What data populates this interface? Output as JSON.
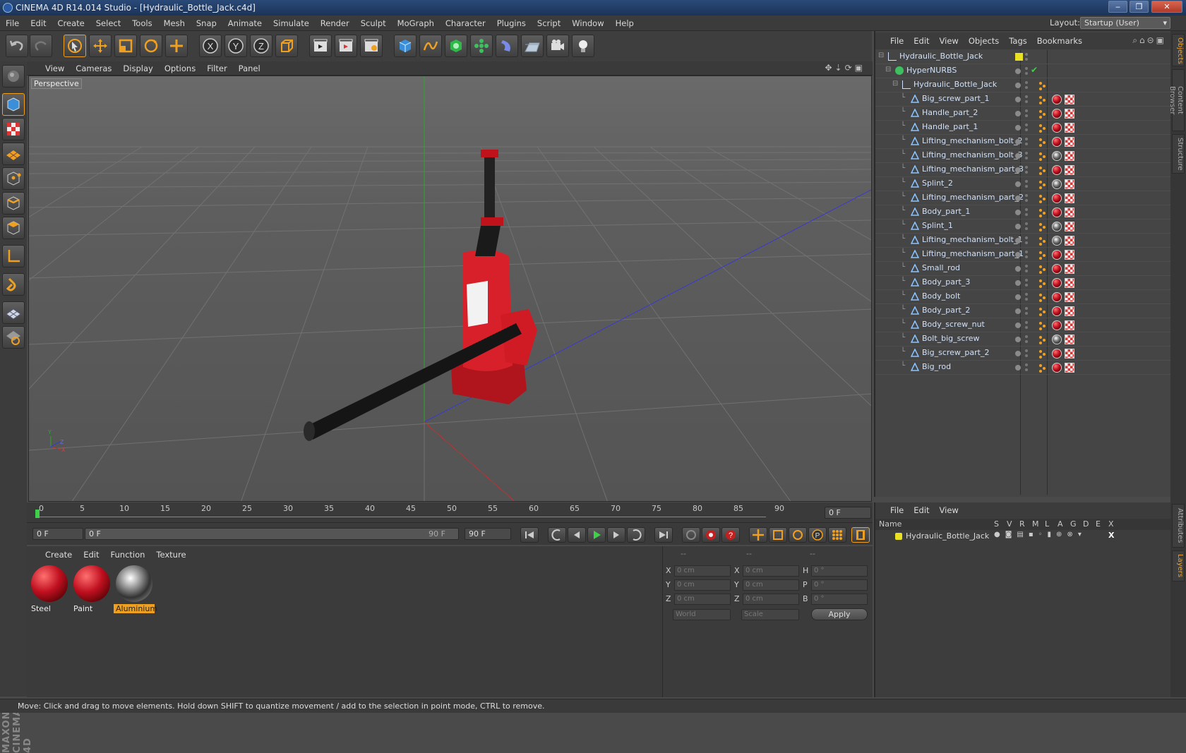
{
  "window": {
    "title": "CINEMA 4D R14.014 Studio - [Hydraulic_Bottle_Jack.c4d]",
    "minimize": "‒",
    "maximize": "❐",
    "close": "✕"
  },
  "menu": [
    "File",
    "Edit",
    "Create",
    "Select",
    "Tools",
    "Mesh",
    "Snap",
    "Animate",
    "Simulate",
    "Render",
    "Sculpt",
    "MoGraph",
    "Character",
    "Plugins",
    "Script",
    "Window",
    "Help"
  ],
  "layout": {
    "label": "Layout:",
    "value": "Startup (User)"
  },
  "toolbar": {
    "icons": [
      "undo-icon",
      "redo-icon",
      "live-selection-icon",
      "move-icon",
      "scale-icon",
      "rotate-icon",
      "add-object-icon",
      "lock-x-icon",
      "lock-y-icon",
      "lock-z-icon",
      "coordinate-system-icon",
      "render-view-icon",
      "render-picture-viewer-icon",
      "render-settings-icon",
      "cube-icon",
      "spline-pen-icon",
      "nurbs-icon",
      "array-icon",
      "deformer-icon",
      "floor-icon",
      "camera-icon",
      "light-icon"
    ]
  },
  "left_tools": {
    "icons": [
      "make-editable-icon",
      "model-mode-icon",
      "texture-mode-icon",
      "workplane-mode-icon",
      "points-mode-icon",
      "edges-mode-icon",
      "polygons-mode-icon",
      "axis-mode-icon",
      "tweak-magnet-icon",
      "snap-grid-icon",
      "snap-lock-icon"
    ]
  },
  "brand": "MAXON CINEMA 4D",
  "viewport": {
    "menu": [
      "View",
      "Cameras",
      "Display",
      "Options",
      "Filter",
      "Panel"
    ],
    "label": "Perspective",
    "axis": {
      "y": "Y",
      "z": "Z",
      "x": "X"
    }
  },
  "timeline": {
    "ticks": [
      "0",
      "5",
      "10",
      "15",
      "20",
      "25",
      "30",
      "35",
      "40",
      "45",
      "50",
      "55",
      "60",
      "65",
      "70",
      "75",
      "80",
      "85",
      "90"
    ],
    "current_frame": "0 F"
  },
  "transport": {
    "start_field": "0 F",
    "range_start": "0 F",
    "range_end": "90 F",
    "end_field": "90 F"
  },
  "materials": {
    "menu": [
      "Create",
      "Edit",
      "Function",
      "Texture"
    ],
    "items": [
      {
        "name": "Steel",
        "selected": false
      },
      {
        "name": "Paint",
        "selected": false
      },
      {
        "name": "Aluminium",
        "selected": true
      }
    ]
  },
  "coordinates": {
    "headers": [
      "--",
      "--",
      "--"
    ],
    "rows": [
      {
        "a": "X",
        "av": "0 cm",
        "b": "X",
        "bv": "0 cm",
        "c": "H",
        "cv": "0 °"
      },
      {
        "a": "Y",
        "av": "0 cm",
        "b": "Y",
        "bv": "0 cm",
        "c": "P",
        "cv": "0 °"
      },
      {
        "a": "Z",
        "av": "0 cm",
        "b": "Z",
        "bv": "0 cm",
        "c": "B",
        "cv": "0 °"
      }
    ],
    "mode": "World",
    "transform": "Scale",
    "apply": "Apply"
  },
  "objects": {
    "menu": [
      "File",
      "Edit",
      "View",
      "Objects",
      "Tags",
      "Bookmarks"
    ],
    "root": "Hydraulic_Bottle_Jack",
    "nurbs": "HyperNURBS",
    "group": "Hydraulic_Bottle_Jack",
    "children": [
      {
        "name": "Big_screw_part_1",
        "mat": "steel"
      },
      {
        "name": "Handle_part_2",
        "mat": "paint"
      },
      {
        "name": "Handle_part_1",
        "mat": "paint"
      },
      {
        "name": "Lifting_mechanism_bolt_2",
        "mat": "paint"
      },
      {
        "name": "Lifting_mechanism_bolt_3",
        "mat": "alu"
      },
      {
        "name": "Lifting_mechanism_part_3",
        "mat": "paint"
      },
      {
        "name": "Splint_2",
        "mat": "alu"
      },
      {
        "name": "Lifting_mechanism_part_2",
        "mat": "paint"
      },
      {
        "name": "Body_part_1",
        "mat": "paint"
      },
      {
        "name": "Splint_1",
        "mat": "alu"
      },
      {
        "name": "Lifting_mechanism_bolt_1",
        "mat": "alu"
      },
      {
        "name": "Lifting_mechanism_part_1",
        "mat": "paint"
      },
      {
        "name": "Small_rod",
        "mat": "paint"
      },
      {
        "name": "Body_part_3",
        "mat": "paint"
      },
      {
        "name": "Body_bolt",
        "mat": "paint"
      },
      {
        "name": "Body_part_2",
        "mat": "paint"
      },
      {
        "name": "Body_screw_nut",
        "mat": "paint"
      },
      {
        "name": "Bolt_big_screw",
        "mat": "alu"
      },
      {
        "name": "Big_screw_part_2",
        "mat": "paint"
      },
      {
        "name": "Big_rod",
        "mat": "paint"
      }
    ]
  },
  "layers": {
    "menu": [
      "File",
      "Edit",
      "View"
    ],
    "columns": [
      "Name",
      "S",
      "V",
      "R",
      "M",
      "L",
      "A",
      "G",
      "D",
      "E",
      "X"
    ],
    "rows": [
      {
        "name": "Hydraulic_Bottle_Jack"
      }
    ]
  },
  "side_tabs": [
    "Objects",
    "Content Browser",
    "Structure",
    "Attributes",
    "Layers"
  ],
  "status": "Move: Click and drag to move elements. Hold down SHIFT to quantize movement / add to the selection in point mode, CTRL to remove.",
  "colors": {
    "accent": "#f0a020",
    "jack_red": "#d8202a",
    "selection_blue": "#2a4a78"
  }
}
